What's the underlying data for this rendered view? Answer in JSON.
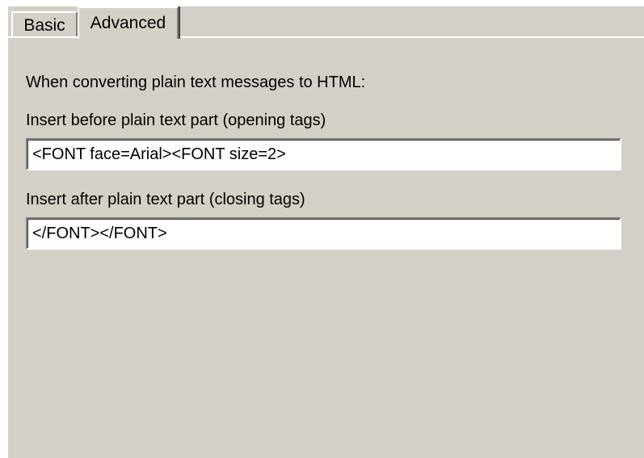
{
  "tabs": [
    {
      "label": "Basic",
      "selected": false
    },
    {
      "label": "Advanced",
      "selected": true
    }
  ],
  "advanced": {
    "intro_text": "When converting plain text messages to HTML:",
    "before_label": "Insert before plain text part (opening tags)",
    "before_value": "<FONT face=Arial><FONT size=2>",
    "after_label": "Insert after plain text part (closing tags)",
    "after_value": "</FONT></FONT>"
  },
  "colors": {
    "dialog_background": "#d4d0c8",
    "field_background": "#ffffff"
  }
}
